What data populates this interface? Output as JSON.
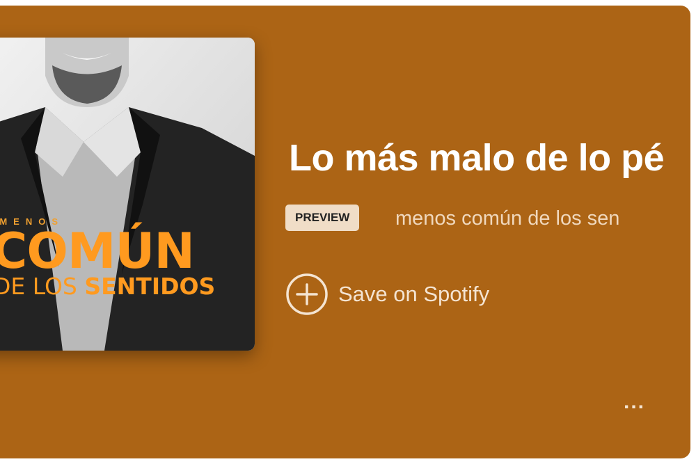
{
  "episode": {
    "title": "Lo más malo de lo pé",
    "badge": "PREVIEW",
    "show_name": "menos común de los sen"
  },
  "actions": {
    "save_label": "Save on Spotify",
    "more_label": "..."
  },
  "cover": {
    "top_text": "L MENOS",
    "main_text": "COMÚN",
    "sub_text_1": "DE LOS ",
    "sub_text_2": "SENTIDOS"
  },
  "colors": {
    "background": "#ac6415",
    "badge_bg": "#f0ddc7",
    "accent_orange": "#ff9a1f"
  }
}
